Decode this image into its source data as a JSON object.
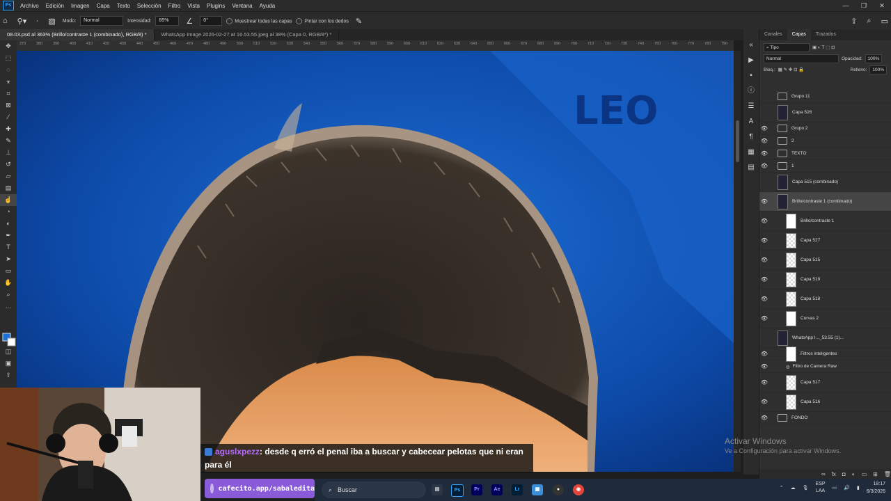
{
  "menu": {
    "app_logo": "Ps",
    "items": [
      "Archivo",
      "Edición",
      "Imagen",
      "Capa",
      "Texto",
      "Selección",
      "Filtro",
      "Vista",
      "Plugins",
      "Ventana",
      "Ayuda"
    ]
  },
  "options": {
    "mode_label": "Modo:",
    "mode_value": "Normal",
    "intensity_label": "Intensidad:",
    "intensity_value": "85%",
    "angle_value": "0°",
    "sample_all_label": "Muestrear todas las capas",
    "finger_label": "Pintar con los dedos"
  },
  "tabs": [
    {
      "label": "08.03.psd al 363% (Brillo/contraste 1 (combinado), RGB/8) *",
      "active": true
    },
    {
      "label": "WhatsApp Image 2026-02-27 at 16.53.55.jpeg al 38% (Capa 0, RGB/8*) *",
      "active": false
    }
  ],
  "ruler_ticks": [
    "370",
    "380",
    "390",
    "400",
    "410",
    "420",
    "430",
    "440",
    "450",
    "460",
    "470",
    "480",
    "490",
    "500",
    "510",
    "520",
    "530",
    "540",
    "550",
    "560",
    "570",
    "580",
    "590",
    "600",
    "610",
    "620",
    "630",
    "640",
    "650",
    "660",
    "670",
    "680",
    "690",
    "700",
    "710",
    "720",
    "730",
    "740",
    "750",
    "760",
    "770",
    "780",
    "790"
  ],
  "canvas": {
    "text_fragment": "LEO"
  },
  "panel": {
    "tabs": [
      "Canales",
      "Capas",
      "Trazados"
    ],
    "active_tab": "Capas",
    "filter_value": "Tipo",
    "blend_mode": "Normal",
    "opacity_label": "Opacidad:",
    "opacity_value": "100%",
    "lock_label": "Bloq.:",
    "fill_label": "Relleno:",
    "fill_value": "100%",
    "layers": [
      {
        "name": "Grupo 11",
        "kind": "folder",
        "visible": false
      },
      {
        "name": "Capa 526",
        "kind": "dark",
        "visible": false
      },
      {
        "name": "Grupo 2",
        "kind": "folder",
        "visible": true
      },
      {
        "name": "2",
        "kind": "folder",
        "visible": true
      },
      {
        "name": "TEXTO",
        "kind": "folder",
        "visible": true
      },
      {
        "name": "1",
        "kind": "folder",
        "visible": true
      },
      {
        "name": "Capa 515 (combinado)",
        "kind": "dark",
        "visible": false
      },
      {
        "name": "Brillo/contraste 1 (combinado)",
        "kind": "dark",
        "visible": true,
        "selected": true
      },
      {
        "name": "Brillo/contraste 1",
        "kind": "adjust",
        "visible": true
      },
      {
        "name": "Capa 527",
        "kind": "check",
        "visible": true
      },
      {
        "name": "Capa 515",
        "kind": "check",
        "visible": true
      },
      {
        "name": "Capa 519",
        "kind": "check",
        "visible": true
      },
      {
        "name": "Capa 518",
        "kind": "check",
        "visible": true
      },
      {
        "name": "Curvas 2",
        "kind": "adjust",
        "visible": true
      },
      {
        "name": "WhatsApp I..._53.55 (1)...",
        "kind": "dark",
        "visible": false
      },
      {
        "name": "Filtros inteligentes",
        "kind": "white",
        "visible": true
      },
      {
        "name": "Filtro de Camera Raw",
        "kind": "sub",
        "visible": true
      },
      {
        "name": "Capa 517",
        "kind": "check",
        "visible": true
      },
      {
        "name": "Capa 516",
        "kind": "check",
        "visible": true
      },
      {
        "name": "FONDO",
        "kind": "folder",
        "visible": true
      }
    ]
  },
  "chat": {
    "user": "aguslxpezz",
    "message": ": desde q erró el penal iba a buscar y cabecear pelotas que ni eran para él"
  },
  "cafecito": "cafecito.app/sabaledita",
  "activate_windows": {
    "line1": "Activar Windows",
    "line2": "Ve a Configuración para activar Windows."
  },
  "taskbar": {
    "search_placeholder": "Buscar",
    "apps": [
      "Ps",
      "Pr",
      "Ae",
      "Lr"
    ],
    "lang": "ESP",
    "lang2": "LAA",
    "time": "18:17",
    "date": "6/3/2026"
  },
  "colors": {
    "canvas_blue": "#0b3b8a",
    "ps_blue": "#31a8ff",
    "selection": "#454545",
    "chat_user": "#b46bff",
    "cafecito": "#8a5bd8"
  }
}
